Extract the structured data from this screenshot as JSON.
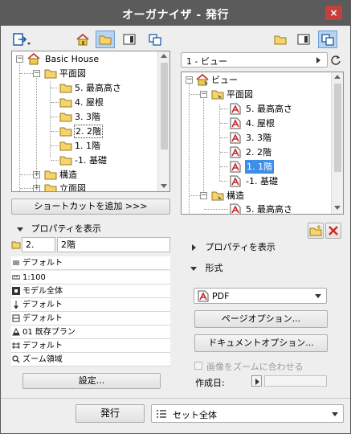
{
  "window": {
    "title": "オーガナイザ - 発行",
    "close_label": "×"
  },
  "left_tree": {
    "root": "Basic House",
    "items": [
      "平面図",
      "5. 最高高さ",
      "4. 屋根",
      "3. 3階",
      "2. 2階",
      "1. 1階",
      "-1. 基礎",
      "構造",
      "立面図"
    ]
  },
  "left_actions": {
    "add_shortcut_label": "ショートカットを追加 >>>"
  },
  "left_properties": {
    "header": "プロパティを表示",
    "id_value": "2.",
    "name_value": "2階",
    "rows": [
      "デフォルト",
      "1:100",
      "モデル全体",
      "デフォルト",
      "デフォルト",
      "01 既存プラン",
      "デフォルト",
      "ズーム領域"
    ],
    "settings_label": "設定..."
  },
  "right_panel": {
    "view_selector": "1 - ビュー",
    "tree_root": "ビュー",
    "items": [
      "平面図",
      "5. 最高高さ",
      "4. 屋根",
      "3. 3階",
      "2. 2階",
      "1. 1階",
      "-1. 基礎",
      "構造",
      "5. 最高高さ"
    ],
    "properties_header": "プロパティを表示",
    "format_header": "形式",
    "format_value": "PDF",
    "page_options_label": "ページオプション...",
    "document_options_label": "ドキュメントオプション...",
    "fit_zoom_label": "画像をズームに合わせる",
    "created_label": "作成日:"
  },
  "bottom": {
    "publish_label": "発行",
    "set_value": "セット全体"
  },
  "colors": {
    "titlebar": "#5b5b5b",
    "close": "#c3403c",
    "selection": "#3d8ee6",
    "pdf_red": "#c62828"
  }
}
